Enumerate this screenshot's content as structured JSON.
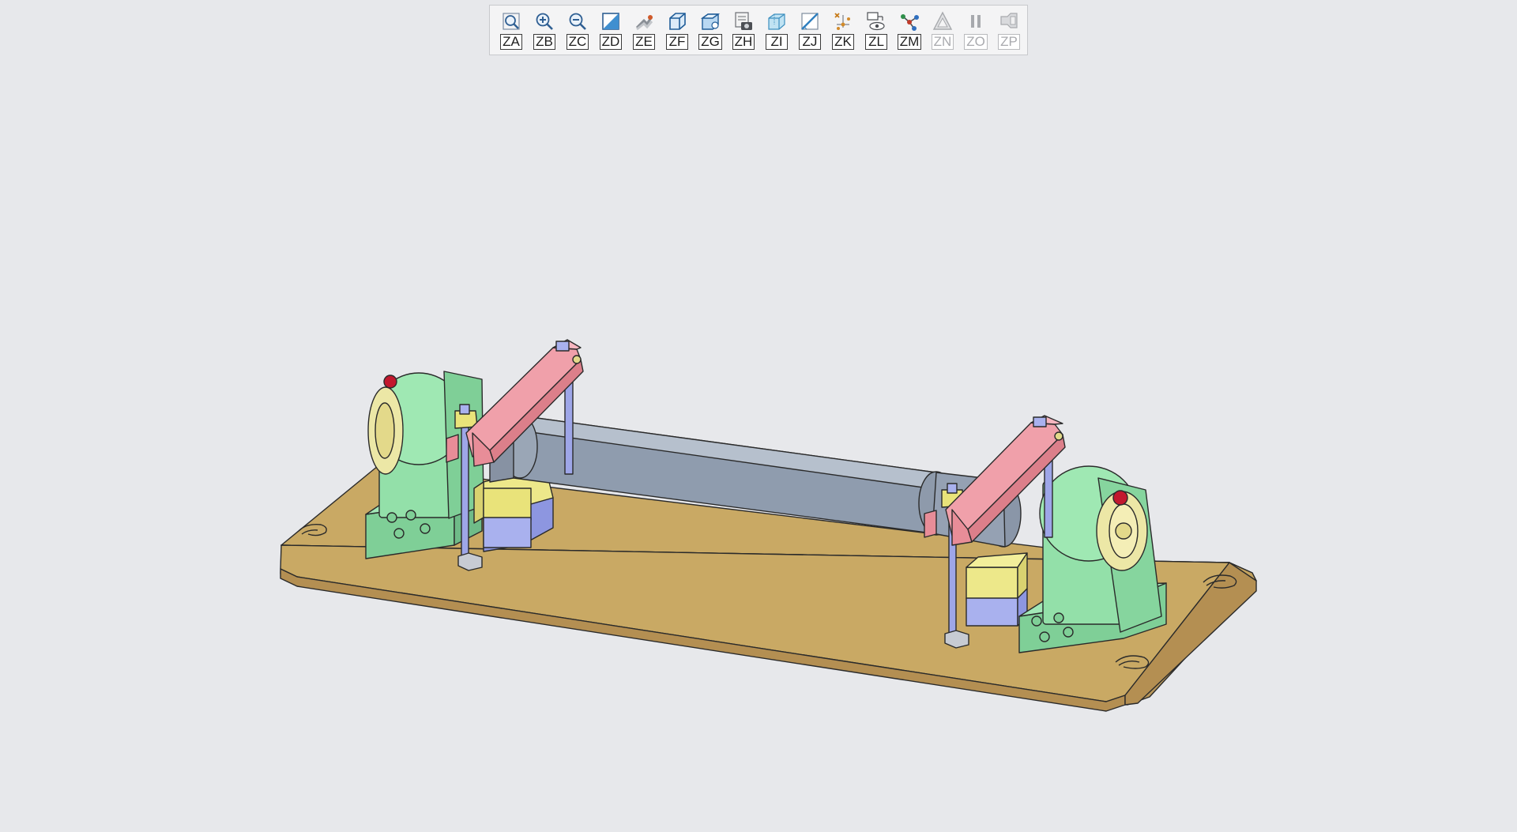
{
  "toolbar": {
    "buttons": [
      {
        "label": "ZA",
        "icon": "zoom-fit-icon",
        "enabled": true
      },
      {
        "label": "ZB",
        "icon": "zoom-in-icon",
        "enabled": true
      },
      {
        "label": "ZC",
        "icon": "zoom-out-icon",
        "enabled": true
      },
      {
        "label": "ZD",
        "icon": "zoom-window-icon",
        "enabled": true
      },
      {
        "label": "ZE",
        "icon": "pan-icon",
        "enabled": true
      },
      {
        "label": "ZF",
        "icon": "view-cube-icon",
        "enabled": true
      },
      {
        "label": "ZG",
        "icon": "named-view-icon",
        "enabled": true
      },
      {
        "label": "ZH",
        "icon": "snapshot-icon",
        "enabled": true
      },
      {
        "label": "ZI",
        "icon": "transparency-icon",
        "enabled": true
      },
      {
        "label": "ZJ",
        "icon": "section-plane-icon",
        "enabled": true
      },
      {
        "label": "ZK",
        "icon": "explode-icon",
        "enabled": true
      },
      {
        "label": "ZL",
        "icon": "display-style-icon",
        "enabled": true
      },
      {
        "label": "ZM",
        "icon": "assembly-tree-icon",
        "enabled": true
      },
      {
        "label": "ZN",
        "icon": "measure-icon",
        "enabled": false
      },
      {
        "label": "ZO",
        "icon": "pause-icon",
        "enabled": false
      },
      {
        "label": "ZP",
        "icon": "annotation-icon",
        "enabled": false
      }
    ]
  },
  "colors": {
    "background": "#e7e8eb",
    "base_plate": "#c9a964",
    "bearing_block": "#93e0a9",
    "clamp_arm": "#f0a0aa",
    "shaft": "#9ba8b8",
    "support_block": "#ede88a",
    "spacer": "#a9b1ee",
    "rod": "#9ea6e8",
    "knob": "#c2182e",
    "collar": "#ece7a6"
  }
}
